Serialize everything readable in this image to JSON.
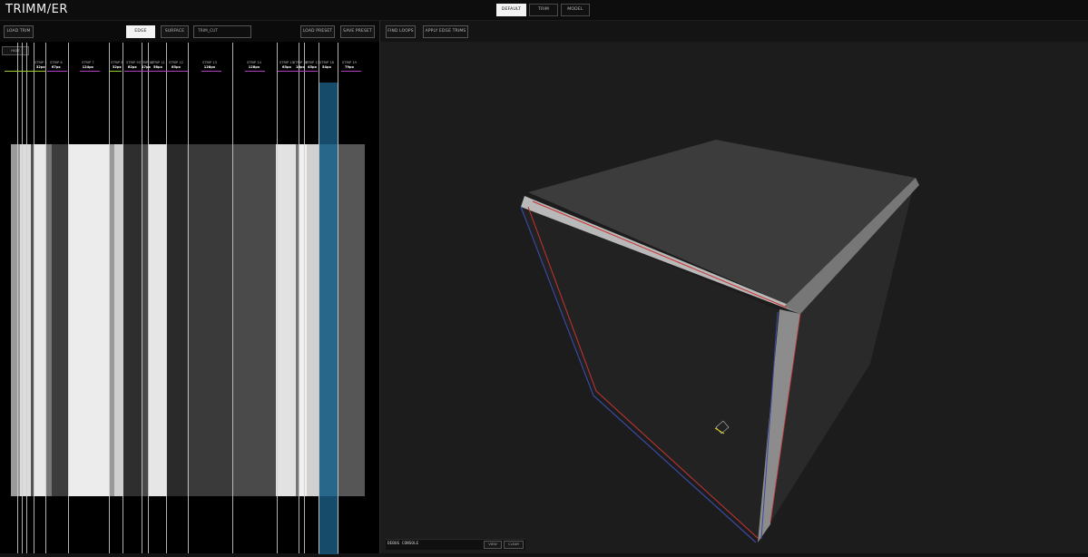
{
  "app": {
    "logo": "TRIMM/ER"
  },
  "modes": [
    {
      "label": "DEFAULT",
      "active": true
    },
    {
      "label": "TRIM",
      "active": false
    },
    {
      "label": "MODEL",
      "active": false
    }
  ],
  "left_toolbar": {
    "load_trim": "LOAD TRIM",
    "edge": "EDGE",
    "surface": "SURFACE",
    "trim_name": "TRIM_CUT",
    "load_preset": "LOAD PRESET",
    "save_preset": "SAVE PRESET",
    "hide": "HIDE"
  },
  "right_toolbar": {
    "find_loops": "FIND LOOPS",
    "apply_edge_trims": "APPLY EDGE TRIMS"
  },
  "strips": [
    {
      "name": "STRIP 6",
      "size": "67px"
    },
    {
      "name": "STRIP 7",
      "size": "124px"
    },
    {
      "name": "STRIP 8",
      "size": "32px"
    },
    {
      "name": "STRIP 9",
      "size": "62px"
    },
    {
      "name": "STRIP 10",
      "size": "17px"
    },
    {
      "name": "STRIP 11",
      "size": "58px"
    },
    {
      "name": "STRIP 12",
      "size": "63px"
    },
    {
      "name": "STRIP 13",
      "size": "128px"
    },
    {
      "name": "STRIP 14",
      "size": "128px"
    },
    {
      "name": "STRIP 15",
      "size": "63px"
    },
    {
      "name": "STRIP 16",
      "size": "16px"
    },
    {
      "name": "STRIP 17",
      "size": "45px"
    },
    {
      "name": "STRIP 18",
      "size": "54px"
    },
    {
      "name": "STRIP 19",
      "size": "79px"
    }
  ],
  "strip_small": {
    "s5": "STRIP 5",
    "s5_size": "32px"
  },
  "console": {
    "label": "DEBUG CONSOLE",
    "view": "VIEW",
    "clear": "CLEAR"
  },
  "colors": {
    "accent_selected": "#1a5a7d",
    "strip_marker_green": "#9acd32",
    "strip_marker_purple": "#b040c0",
    "edge_red": "#c83232",
    "edge_blue": "#3a4aa0"
  }
}
